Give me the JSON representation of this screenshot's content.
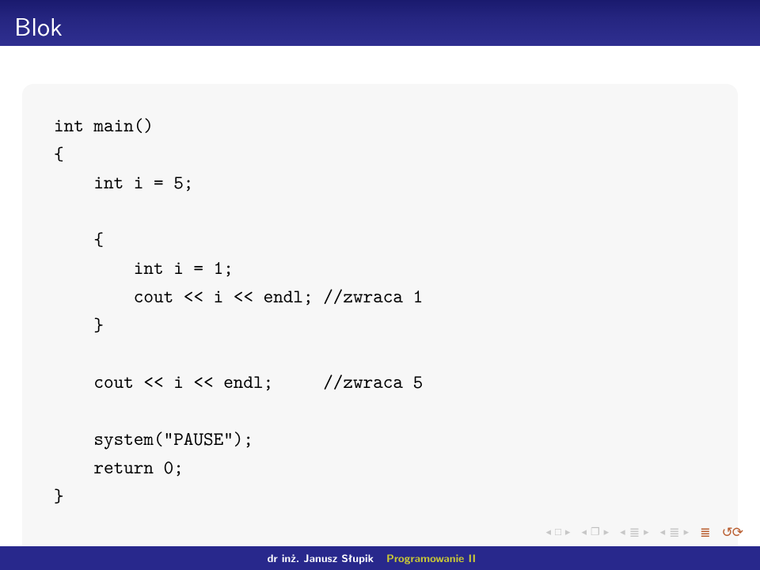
{
  "header": {
    "title": "Blok"
  },
  "code": {
    "l1": "int main()",
    "l2": "{",
    "l3": "    int i = 5;",
    "l4": "",
    "l5": "    {",
    "l6": "        int i = 1;",
    "l7": "        cout << i << endl; //zwraca 1",
    "l8": "    }",
    "l9": "",
    "l10": "    cout << i << endl;     //zwraca 5",
    "l11": "",
    "l12": "    system(\"PAUSE\");",
    "l13": "    return 0;",
    "l14": "}"
  },
  "footer": {
    "author": "dr inż. Janusz Słupik",
    "title": "Programowanie II"
  },
  "nav": {
    "first_glyph": "□",
    "overlap_glyph": "❐",
    "equiv_glyph": "≣",
    "loop_glyph": "↺⟳"
  }
}
